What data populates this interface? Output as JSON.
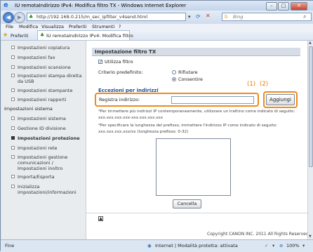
{
  "window": {
    "title": "IU remotaIndirizzo IPv4: Modifica filtro TX                    - Windows Internet Explorer",
    "minimize": "–",
    "maximize": "□",
    "close": "✕"
  },
  "address_bar": {
    "url": "http://192.168.0.215/m_sec_ipfilter_v4send.html",
    "search_placeholder": "Bing"
  },
  "menu": [
    "File",
    "Modifica",
    "Visualizza",
    "Preferiti",
    "Strumenti",
    "?"
  ],
  "favorites_bar": {
    "favorites_label": "Preferiti",
    "tab_title": "IU remotaIndirizzo IPv4: Modifica filtro"
  },
  "left_nav": [
    {
      "label": "Impostazioni copiatura",
      "active": false
    },
    {
      "label": "Impostazioni fax",
      "active": false
    },
    {
      "label": "Impostazioni scansione",
      "active": false
    },
    {
      "label": "Impostazioni stampa diretta da USB",
      "active": false
    },
    {
      "label": "Impostazioni stampante",
      "active": false
    },
    {
      "label": "Impostazioni rapporti",
      "active": false
    },
    {
      "label": "Impostazioni sistema",
      "header": true
    },
    {
      "label": "Impostazioni sistema",
      "active": false
    },
    {
      "label": "Gestione ID divisione",
      "active": false
    },
    {
      "label": "Impostazioni protezione",
      "active": true
    },
    {
      "label": "Impostazioni rete",
      "active": false
    },
    {
      "label": "Impostazioni gestione comunicazioni / Impostazioni inoltro",
      "active": false
    },
    {
      "label": "Importa/Esporta",
      "active": false
    },
    {
      "label": "Inizializza impostazioni/informazioni",
      "active": false
    }
  ],
  "main": {
    "section_title": "Impostazione filtro TX",
    "use_filter_label": "Utilizza filtro",
    "default_policy_label": "Criterio predefinito:",
    "policy_options": [
      "Rifiutare",
      "Consentire"
    ],
    "selected_policy": "Consentire",
    "exceptions_title": "Eccezioni per indirizzi",
    "register_address_label": "Registra indirizzo:",
    "register_address_value": "",
    "add_button": "Aggiungi",
    "help_text_1": "*Per immettere più indirizzi IP contemporaneamente, utilizzare un trattino come indicato di seguito:",
    "help_example_1": "xxx.xxx.xxx.xxx-xxx.xxx.xxx.xxx",
    "help_text_2": "*Per specificare la lunghezza del prefisso, immettere l'indirizzo IP come indicato di seguito:",
    "help_example_2": "xxx.xxx.xxx.xxx/xx (lunghezza prefisso: 0-32)",
    "delete_button": "Cancella",
    "callout_1": "(1)",
    "callout_2": "(2)",
    "copyright": "Copyright CANON INC. 2011 All Rights Reserved"
  },
  "status_bar": {
    "left": "Fine",
    "zone": "Internet | Modalità protetta: attivata",
    "zoom": "100%"
  }
}
